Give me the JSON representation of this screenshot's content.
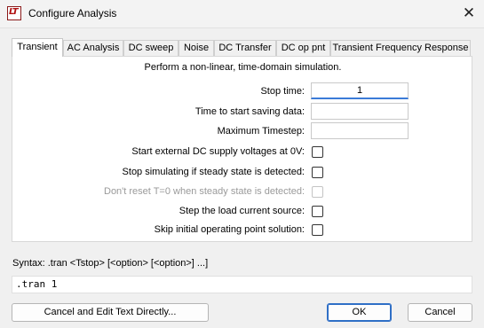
{
  "window": {
    "title": "Configure Analysis",
    "close_glyph": "✕",
    "app_icon_text": "LT"
  },
  "tabs": [
    {
      "label": "Transient",
      "active": true
    },
    {
      "label": "AC Analysis",
      "active": false
    },
    {
      "label": "DC sweep",
      "active": false
    },
    {
      "label": "Noise",
      "active": false
    },
    {
      "label": "DC Transfer",
      "active": false
    },
    {
      "label": "DC op pnt",
      "active": false
    },
    {
      "label": "Transient Frequency Response",
      "active": false
    }
  ],
  "transient": {
    "description": "Perform a non-linear, time-domain simulation.",
    "fields": [
      {
        "label": "Stop time:",
        "value": "1"
      },
      {
        "label": "Time to start saving data:",
        "value": ""
      },
      {
        "label": "Maximum Timestep:",
        "value": ""
      }
    ],
    "options": [
      {
        "label": "Start external DC supply voltages at 0V:",
        "checked": false,
        "enabled": true
      },
      {
        "label": "Stop simulating if steady state is detected:",
        "checked": false,
        "enabled": true
      },
      {
        "label": "Don't reset T=0 when steady state is detected:",
        "checked": false,
        "enabled": false
      },
      {
        "label": "Step the load current source:",
        "checked": false,
        "enabled": true
      },
      {
        "label": "Skip initial operating point solution:",
        "checked": false,
        "enabled": true
      }
    ]
  },
  "syntax": {
    "text": "Syntax:  .tran <Tstop> [<option> [<option>] ...]"
  },
  "command": {
    "value": ".tran 1"
  },
  "buttons": {
    "edit_directly": "Cancel and Edit Text Directly...",
    "ok": "OK",
    "cancel": "Cancel"
  },
  "colors": {
    "accent": "#2f6fc6",
    "disabled_text": "#9a9a9a"
  }
}
